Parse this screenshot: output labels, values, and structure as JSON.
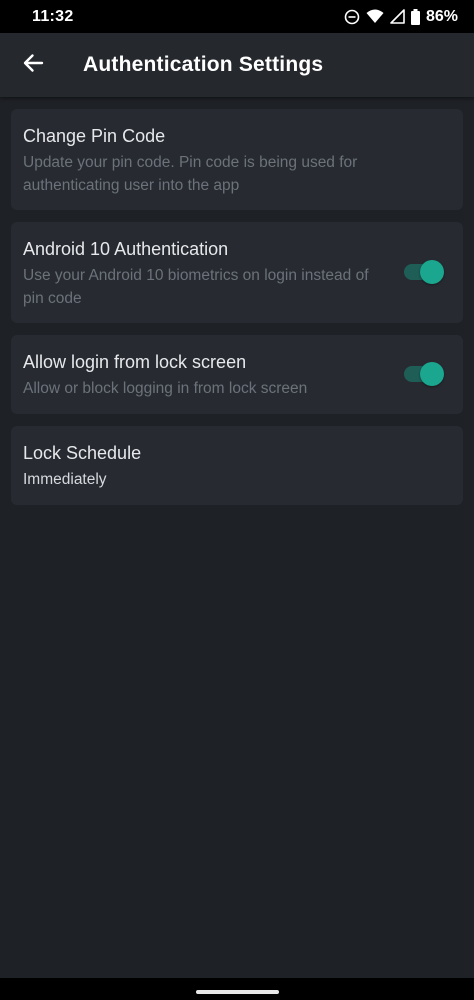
{
  "status_bar": {
    "time": "11:32",
    "battery": "86%",
    "icons": [
      "dnd-icon",
      "wifi-icon",
      "signal-icon",
      "battery-icon"
    ]
  },
  "app_bar": {
    "title": "Authentication Settings",
    "back_icon": "arrow-left-icon"
  },
  "settings": {
    "change_pin": {
      "title": "Change Pin Code",
      "subtitle": "Update your pin code. Pin code is being used for authenticating user into the app"
    },
    "android_auth": {
      "title": "Android 10 Authentication",
      "subtitle": "Use your Android 10 biometrics on login instead of pin code",
      "enabled": true
    },
    "lock_screen_login": {
      "title": "Allow login from lock screen",
      "subtitle": "Allow or block logging in from lock screen",
      "enabled": true
    },
    "lock_schedule": {
      "title": "Lock Schedule",
      "value": "Immediately"
    }
  },
  "colors": {
    "background": "#1e2126",
    "card": "#272b31",
    "app_bar": "#25282d",
    "accent": "#1aa68f",
    "toggle_track": "#1e5e57",
    "secondary_text": "#6c727a"
  }
}
